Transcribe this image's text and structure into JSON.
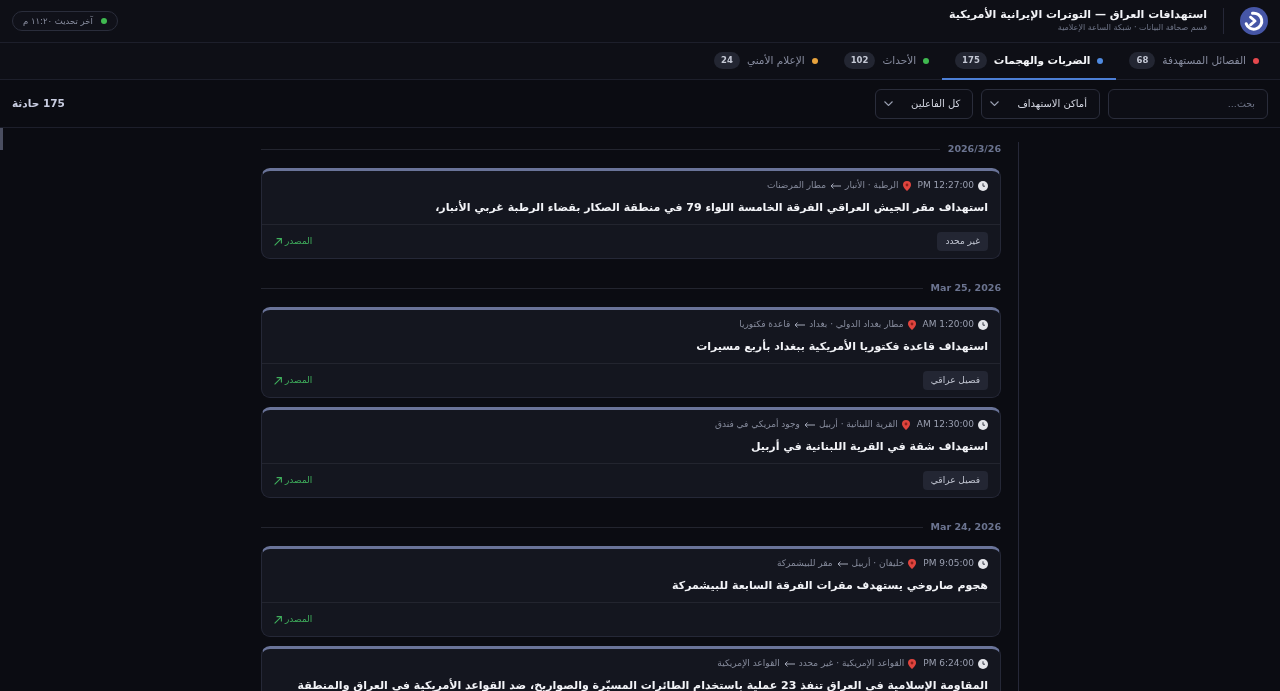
{
  "header": {
    "title": "استهدافات العراق — التوترات الإيرانية الأمريكية",
    "subtitle": "قسم صحافة البيانات · شبكة الساعة الإعلامية",
    "last_update": "آخر تحديث ١١:٢٠ م"
  },
  "tabs": [
    {
      "label": "الفصائل المستهدفة",
      "count": "68",
      "color": "#e5484d",
      "selected": false
    },
    {
      "label": "الضربات والهجمات",
      "count": "175",
      "color": "#4f8ae0",
      "selected": true
    },
    {
      "label": "الأحداث",
      "count": "102",
      "color": "#3fb950",
      "selected": false
    },
    {
      "label": "الإعلام الأمني",
      "count": "24",
      "color": "#e8a33d",
      "selected": false
    }
  ],
  "filters": {
    "search": {
      "placeholder": "بحث..."
    },
    "dropdowns": [
      {
        "value": "أماكن الاستهداف"
      },
      {
        "value": "كل الفاعلين"
      }
    ]
  },
  "result_count": "175 حادثة",
  "groups": [
    {
      "date": "2026/3/26",
      "incidents": [
        {
          "time": "12:27:00 PM",
          "location": "الرطبة · الأنبار",
          "target": "مطار المرضنات",
          "title": "استهداف مقر الجيش العراقي الفرقة الخامسة اللواء 79 في منطقة الصكار بقضاء الرطبة غربي الأنبار،",
          "tag": "غير محدد",
          "source": "المصدر"
        }
      ]
    },
    {
      "date": "Mar 25, 2026",
      "incidents": [
        {
          "time": "1:20:00 AM",
          "location": "مطار بغداد الدولي · بغداد",
          "target": "قاعدة فكتوريا",
          "title": "استهداف قاعدة فكتوريا الأمريكية ببغداد بأربع مسيرات",
          "tag": "فصيل عراقي",
          "source": "المصدر"
        },
        {
          "time": "12:30:00 AM",
          "location": "القرية اللبنانية · أربيل",
          "target": "وجود أمريكي في فندق",
          "title": "استهداف شقة في القرية اللبنانية في أربيل",
          "tag": "فصيل عراقي",
          "source": "المصدر"
        }
      ]
    },
    {
      "date": "Mar 24, 2026",
      "incidents": [
        {
          "time": "9:05:00 PM",
          "location": "خليفان · أربيل",
          "target": "مقر للبيشمركة",
          "title": "هجوم صاروخي يستهدف مقرات الفرقة السابعة للبيشمركة",
          "source": "المصدر"
        },
        {
          "time": "6:24:00 PM",
          "location": "القواعد الإمريكية · غير محدد",
          "target": "القواعد الإمريكية",
          "title": "المقاومة الإسلامية في العراق تنفذ 23 عملية باستخدام الطائرات المسيّرة والصواريخ، ضد القواعد الأمريكية في العراق والمنطقة"
        }
      ]
    }
  ]
}
